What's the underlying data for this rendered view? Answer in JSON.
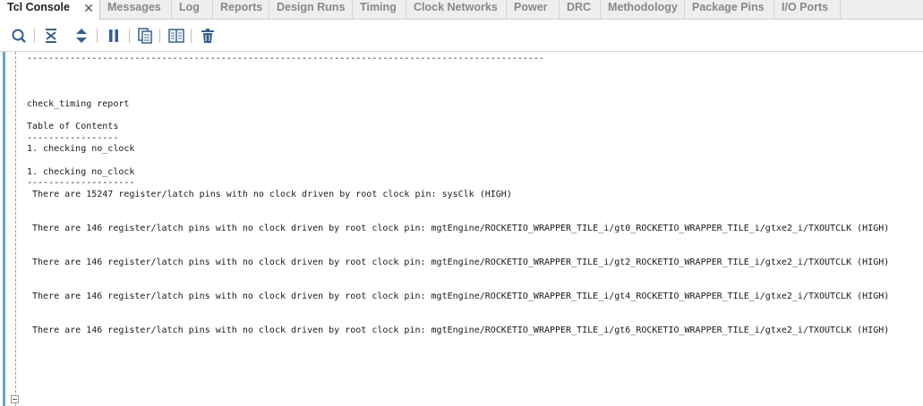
{
  "tabs": [
    {
      "label": "Tcl Console",
      "active": true,
      "closable": true
    },
    {
      "label": "Messages"
    },
    {
      "label": "Log"
    },
    {
      "label": "Reports"
    },
    {
      "label": "Design Runs"
    },
    {
      "label": "Timing"
    },
    {
      "label": "Clock Networks"
    },
    {
      "label": "Power"
    },
    {
      "label": "DRC"
    },
    {
      "label": "Methodology"
    },
    {
      "label": "Package Pins"
    },
    {
      "label": "I/O Ports"
    }
  ],
  "toolbar": {
    "icons": [
      "search-icon",
      "collapse-all-icon",
      "expand-all-icon",
      "pause-icon",
      "copy-icon",
      "split-icon",
      "clear-icon"
    ]
  },
  "colors": {
    "accent_bar": "#6f9ed6",
    "icon": "#3a5f8c"
  },
  "console": {
    "lines": [
      "------------------------------------------------------------------------------------------------",
      "",
      "",
      "",
      "check_timing report",
      "",
      "Table of Contents",
      "-----------------",
      "1. checking no_clock",
      "",
      "1. checking no_clock",
      "--------------------",
      " There are 15247 register/latch pins with no clock driven by root clock pin: sysClk (HIGH)",
      "",
      "",
      " There are 146 register/latch pins with no clock driven by root clock pin: mgtEngine/ROCKETIO_WRAPPER_TILE_i/gt0_ROCKETIO_WRAPPER_TILE_i/gtxe2_i/TXOUTCLK (HIGH)",
      "",
      "",
      " There are 146 register/latch pins with no clock driven by root clock pin: mgtEngine/ROCKETIO_WRAPPER_TILE_i/gt2_ROCKETIO_WRAPPER_TILE_i/gtxe2_i/TXOUTCLK (HIGH)",
      "",
      "",
      " There are 146 register/latch pins with no clock driven by root clock pin: mgtEngine/ROCKETIO_WRAPPER_TILE_i/gt4_ROCKETIO_WRAPPER_TILE_i/gtxe2_i/TXOUTCLK (HIGH)",
      "",
      "",
      " There are 146 register/latch pins with no clock driven by root clock pin: mgtEngine/ROCKETIO_WRAPPER_TILE_i/gt6_ROCKETIO_WRAPPER_TILE_i/gtxe2_i/TXOUTCLK (HIGH)"
    ]
  }
}
